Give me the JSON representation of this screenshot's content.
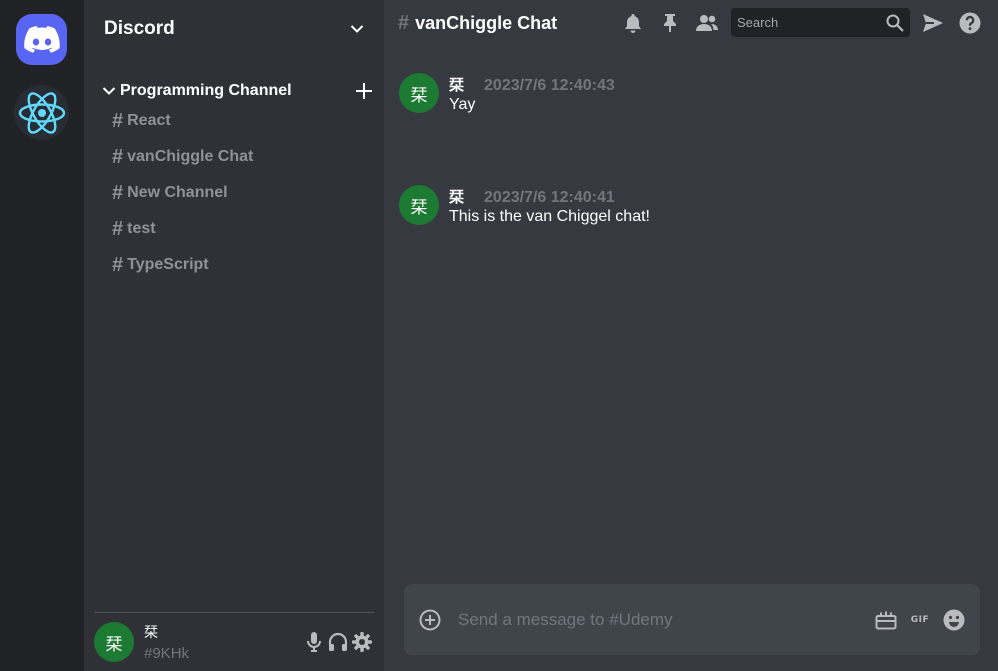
{
  "servers": [
    {
      "name": "discord-logo",
      "icon": "discord-icon"
    },
    {
      "name": "react-server",
      "icon": "react-icon"
    }
  ],
  "sidebar": {
    "server_name": "Discord",
    "category": "Programming Channel",
    "channels": [
      "React",
      "vanChiggle Chat",
      "New Channel",
      "test",
      "TypeScript"
    ],
    "channel_hash": "#"
  },
  "user": {
    "avatar_text": "栞",
    "name": "栞",
    "tag": "#9KHk"
  },
  "chat": {
    "hash": "#",
    "title": "vanChiggle Chat",
    "search_placeholder": "Search",
    "messages": [
      {
        "avatar_text": "栞",
        "author": "栞",
        "time": "2023/7/6 12:40:43",
        "text": "Yay"
      },
      {
        "avatar_text": "栞",
        "author": "栞",
        "time": "2023/7/6 12:40:41",
        "text": "This is the van Chiggel chat!"
      }
    ],
    "composer_placeholder": "Send a message to #Udemy",
    "gif_label": "GIF"
  },
  "colors": {
    "rail": "#202225",
    "sidebar": "#2f3136",
    "chat": "#36393f",
    "blurple": "#5865f2",
    "avatar_green": "#1d7a33",
    "react_cyan": "#61dafb"
  }
}
